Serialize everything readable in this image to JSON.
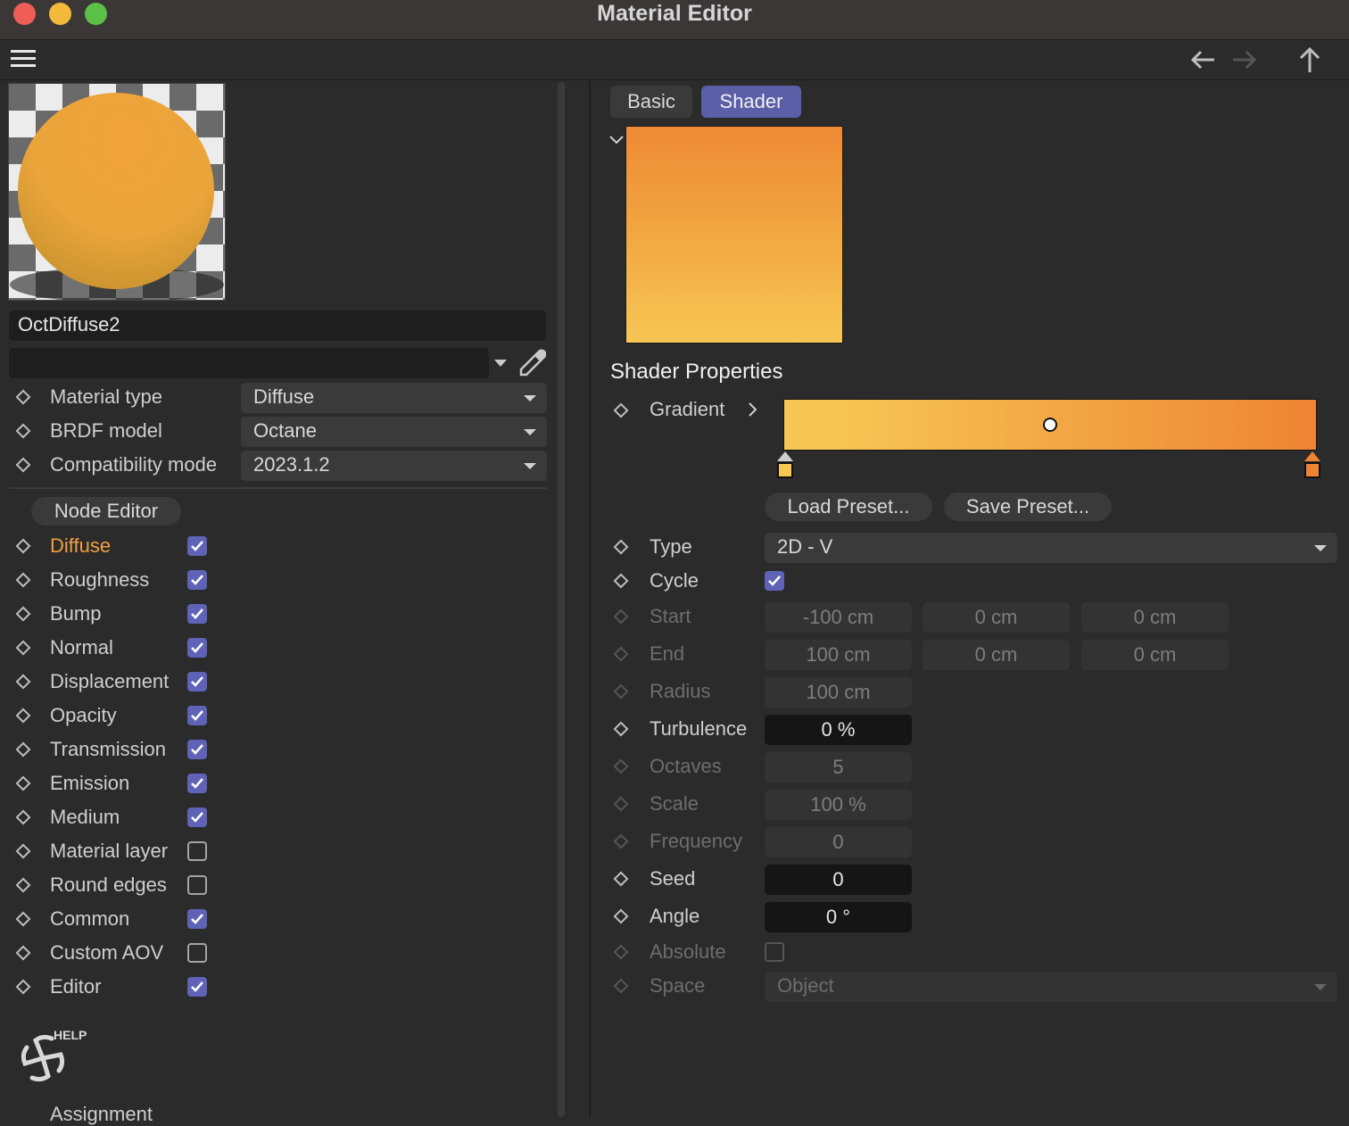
{
  "window": {
    "title": "Material Editor"
  },
  "nav": {
    "back": "back-arrow",
    "forward": "forward-arrow",
    "up": "up-arrow"
  },
  "left": {
    "material_name": "OctDiffuse2",
    "search_value": "",
    "properties": [
      {
        "label": "Material type",
        "value": "Diffuse"
      },
      {
        "label": "BRDF model",
        "value": "Octane"
      },
      {
        "label": "Compatibility mode",
        "value": "2023.1.2"
      }
    ],
    "node_editor": "Node Editor",
    "channels": [
      {
        "label": "Diffuse",
        "checked": true,
        "active": true
      },
      {
        "label": "Roughness",
        "checked": true
      },
      {
        "label": "Bump",
        "checked": true
      },
      {
        "label": "Normal",
        "checked": true
      },
      {
        "label": "Displacement",
        "checked": true
      },
      {
        "label": "Opacity",
        "checked": true
      },
      {
        "label": "Transmission",
        "checked": true
      },
      {
        "label": "Emission",
        "checked": true
      },
      {
        "label": "Medium",
        "checked": true
      },
      {
        "label": "Material layer",
        "checked": false
      },
      {
        "label": "Round edges",
        "checked": false
      },
      {
        "label": "Common",
        "checked": true
      },
      {
        "label": "Custom AOV",
        "checked": false
      },
      {
        "label": "Editor",
        "checked": true
      }
    ],
    "help": "HELP",
    "assignment": "Assignment"
  },
  "right": {
    "tabs": [
      {
        "label": "Basic",
        "active": false
      },
      {
        "label": "Shader",
        "active": true
      }
    ],
    "section_title": "Shader Properties",
    "gradient_label": "Gradient",
    "gradient_colors": [
      "#f7c654",
      "#ee8433"
    ],
    "load_preset": "Load Preset...",
    "save_preset": "Save Preset...",
    "type": {
      "label": "Type",
      "value": "2D - V"
    },
    "cycle": {
      "label": "Cycle",
      "checked": true
    },
    "start": {
      "label": "Start",
      "values": [
        "-100 cm",
        "0 cm",
        "0 cm"
      ]
    },
    "end": {
      "label": "End",
      "values": [
        "100 cm",
        "0 cm",
        "0 cm"
      ]
    },
    "radius": {
      "label": "Radius",
      "value": "100 cm"
    },
    "turbulence": {
      "label": "Turbulence",
      "value": "0 %"
    },
    "octaves": {
      "label": "Octaves",
      "value": "5"
    },
    "scale": {
      "label": "Scale",
      "value": "100 %"
    },
    "frequency": {
      "label": "Frequency",
      "value": "0"
    },
    "seed": {
      "label": "Seed",
      "value": "0"
    },
    "angle": {
      "label": "Angle",
      "value": "0 °"
    },
    "absolute": {
      "label": "Absolute",
      "checked": false
    },
    "space": {
      "label": "Space",
      "value": "Object"
    }
  }
}
